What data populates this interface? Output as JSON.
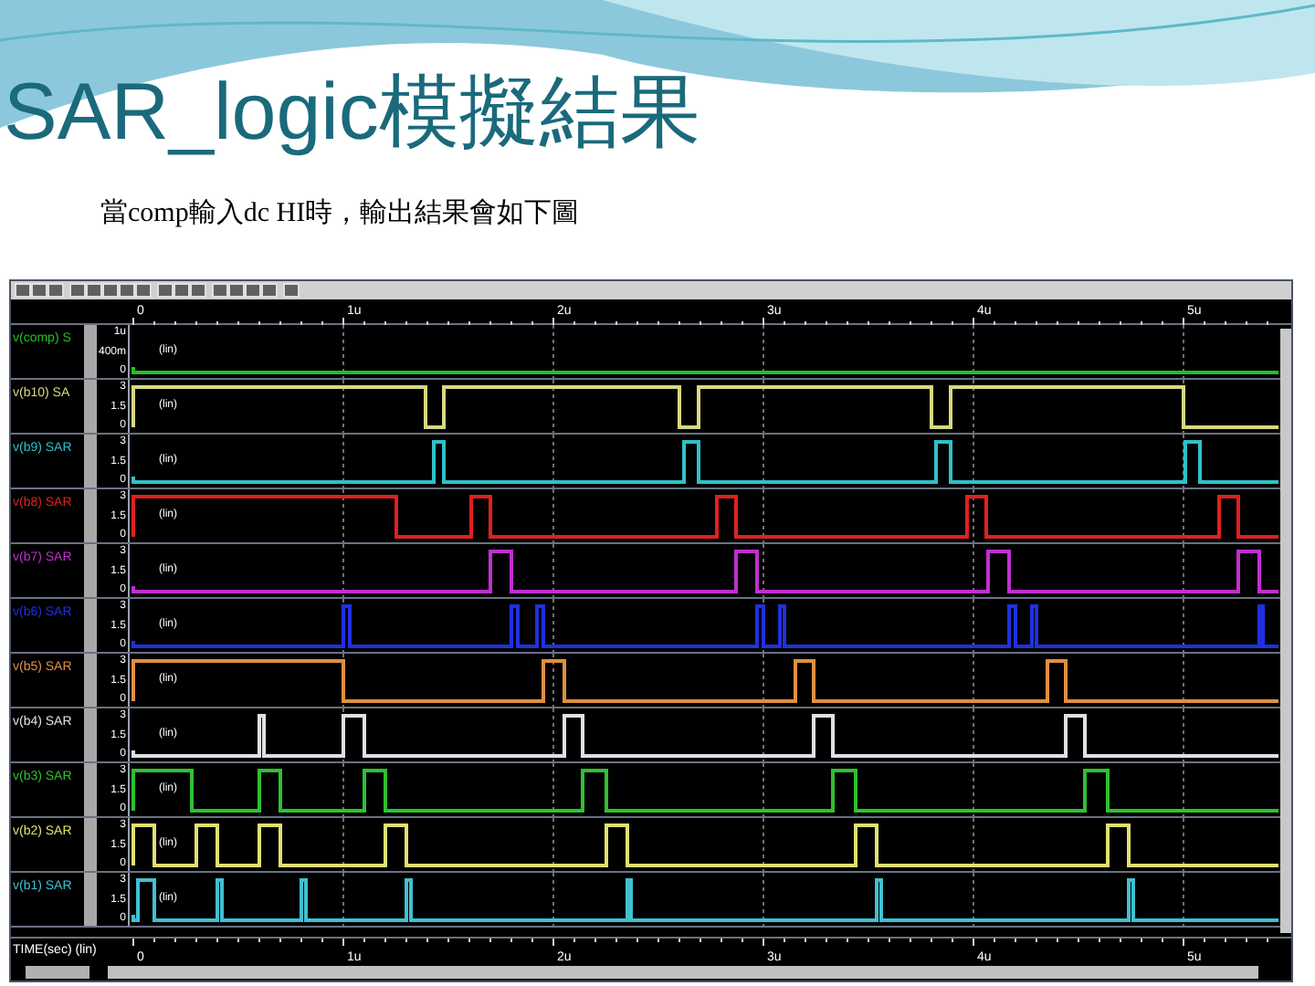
{
  "slide": {
    "title": "SAR_logic模擬結果",
    "caption": "當comp輸入dc HI時，輸出結果會如下圖"
  },
  "waveform_viewer": {
    "top_axis_ticks": [
      "0",
      "1u",
      "2u",
      "3u",
      "4u",
      "5u"
    ],
    "signals": [
      {
        "name": "v(comp) S",
        "color": "#22c022",
        "ticks": [
          "1u",
          "400m",
          "0"
        ],
        "scale": "(lin)"
      },
      {
        "name": "v(b10) SA",
        "color": "#d8d880",
        "ticks": [
          "3",
          "1.5",
          "0"
        ],
        "scale": "(lin)"
      },
      {
        "name": "v(b9) SAR",
        "color": "#30c0c8",
        "ticks": [
          "3",
          "1.5",
          "0"
        ],
        "scale": "(lin)"
      },
      {
        "name": "v(b8) SAR",
        "color": "#e02020",
        "ticks": [
          "3",
          "1.5",
          "0"
        ],
        "scale": "(lin)"
      },
      {
        "name": "v(b7) SAR",
        "color": "#c030d0",
        "ticks": [
          "3",
          "1.5",
          "0"
        ],
        "scale": "(lin)"
      },
      {
        "name": "v(b6) SAR",
        "color": "#2030e0",
        "ticks": [
          "3",
          "1.5",
          "0"
        ],
        "scale": "(lin)"
      },
      {
        "name": "v(b5) SAR",
        "color": "#e09040",
        "ticks": [
          "3",
          "1.5",
          "0"
        ],
        "scale": "(lin)"
      },
      {
        "name": "v(b4) SAR",
        "color": "#e0e0e0",
        "ticks": [
          "3",
          "1.5",
          "0"
        ],
        "scale": "(lin)"
      },
      {
        "name": "v(b3) SAR",
        "color": "#30c030",
        "ticks": [
          "3",
          "1.5",
          "0"
        ],
        "scale": "(lin)"
      },
      {
        "name": "v(b2) SAR",
        "color": "#e0e070",
        "ticks": [
          "3",
          "1.5",
          "0"
        ],
        "scale": "(lin)"
      },
      {
        "name": "v(b1) SAR",
        "color": "#40c0d0",
        "ticks": [
          "3",
          "1.5",
          "0"
        ],
        "scale": "(lin)"
      }
    ],
    "x_axis": {
      "label": "TIME(sec) (lin)",
      "ticks": [
        "0",
        "1u",
        "2u",
        "3u",
        "4u",
        "5u"
      ]
    }
  }
}
